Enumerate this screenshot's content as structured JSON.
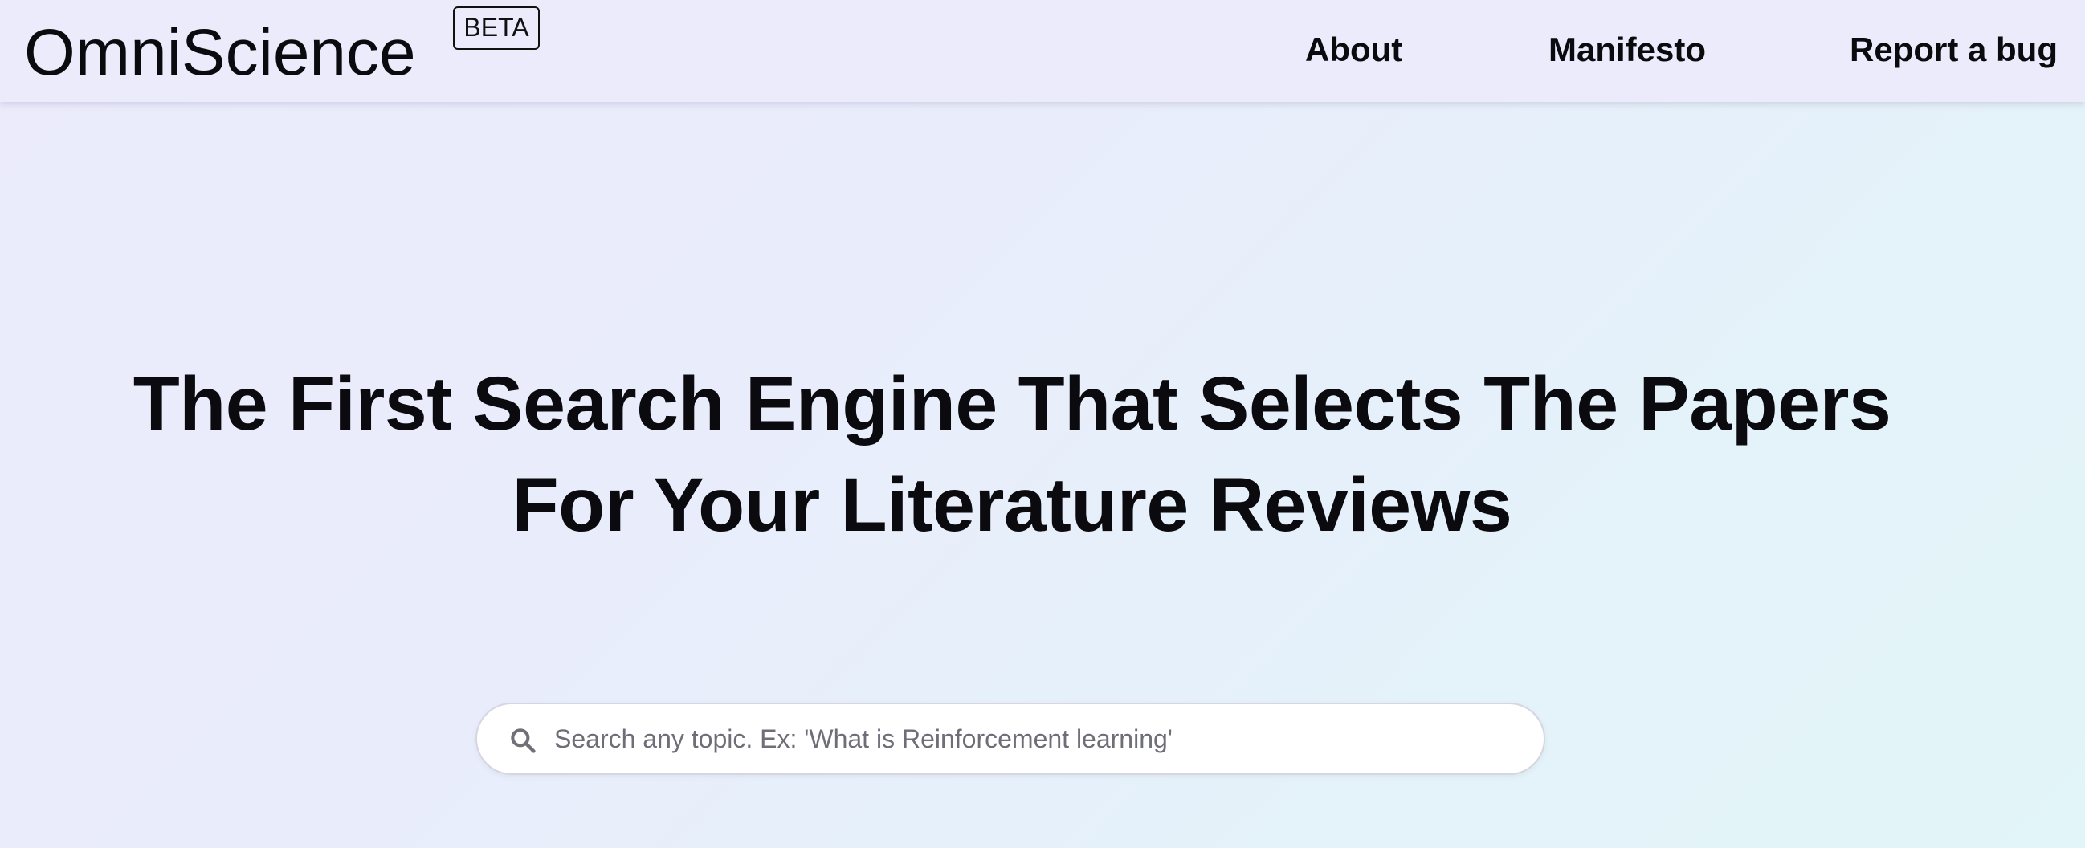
{
  "header": {
    "brand": "OmniScience",
    "badge": "BETA",
    "nav": {
      "about": "About",
      "manifesto": "Manifesto",
      "report_bug": "Report a bug"
    }
  },
  "hero": {
    "line1": "The First Search Engine That Selects The Papers",
    "line2": "For Your Literature Reviews"
  },
  "search": {
    "icon": "search-icon",
    "value": "",
    "placeholder": "Search any topic. Ex: 'What is Reinforcement learning'"
  },
  "colors": {
    "header_bg": "#ebebfc",
    "text": "#0b0b0f",
    "placeholder": "#6e6e78",
    "search_bg": "#ffffff"
  }
}
